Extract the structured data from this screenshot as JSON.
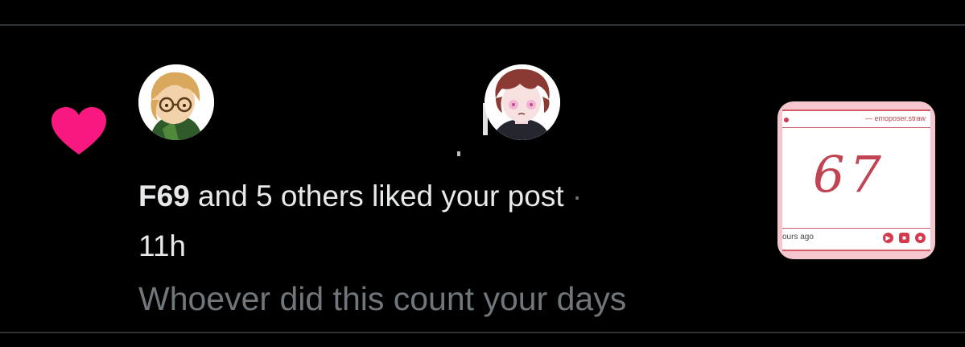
{
  "notification": {
    "type": "like",
    "icon": "heart-icon",
    "accent_color": "#f91880",
    "user": "F69",
    "action_text": " and 5 others liked your post",
    "separator": " ·",
    "time": "11h",
    "post_text": "Whoever did this count your days"
  },
  "thumbnail": {
    "credit": "— emoposer.straw",
    "number": "67",
    "footer": "ours ago",
    "controls": [
      "play-icon",
      "save-icon",
      "face-icon"
    ]
  },
  "colors": {
    "background": "#000000",
    "primary_text": "#e7e9ea",
    "secondary_text": "#71767b",
    "divider": "#2f3336"
  }
}
